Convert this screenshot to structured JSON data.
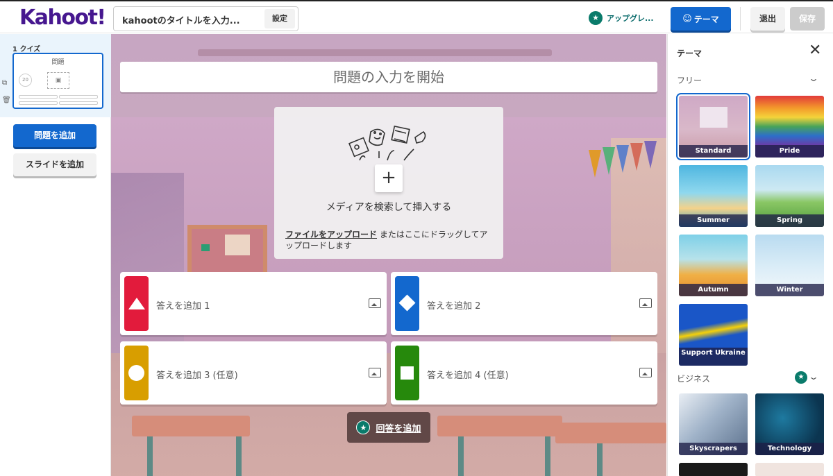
{
  "topbar": {
    "logo": "Kahoot!",
    "title_input": "kahootのタイトルを入力...",
    "settings_label": "設定",
    "upgrade_label": "アップグレ...",
    "theme_label": "テーマ",
    "exit_label": "退出",
    "save_label": "保存"
  },
  "sidebar": {
    "slide_label": "1 クイズ",
    "thumb_question": "問題",
    "thumb_timer": "20",
    "add_question_label": "問題を追加",
    "add_slide_label": "スライドを追加"
  },
  "editor": {
    "question_placeholder": "問題の入力を開始",
    "media_label": "メディアを検索して挿入する",
    "upload_link": "ファイルをアップロード",
    "upload_rest": " またはここにドラッグしてアップロードします",
    "answers": [
      {
        "label": "答えを追加 1",
        "color": "#e21b3c",
        "shape": "triangle"
      },
      {
        "label": "答えを追加 2",
        "color": "#1368ce",
        "shape": "diamond"
      },
      {
        "label": "答えを追加 3 (任意)",
        "color": "#d89e00",
        "shape": "circle"
      },
      {
        "label": "答えを追加 4 (任意)",
        "color": "#26890c",
        "shape": "square"
      }
    ],
    "add_answer_label": "回答を追加"
  },
  "theme_panel": {
    "title": "テーマ",
    "free_section": "フリー",
    "business_section": "ビジネス",
    "free_themes": [
      "Standard",
      "Pride",
      "Summer",
      "Spring",
      "Autumn",
      "Winter",
      "Support Ukraine"
    ],
    "business_themes": [
      "Skyscrapers",
      "Technology"
    ],
    "selected_theme": "Standard"
  },
  "colors": {
    "brand": "#46178f",
    "primary": "#1368ce",
    "upgrade": "#0a7b6b"
  }
}
